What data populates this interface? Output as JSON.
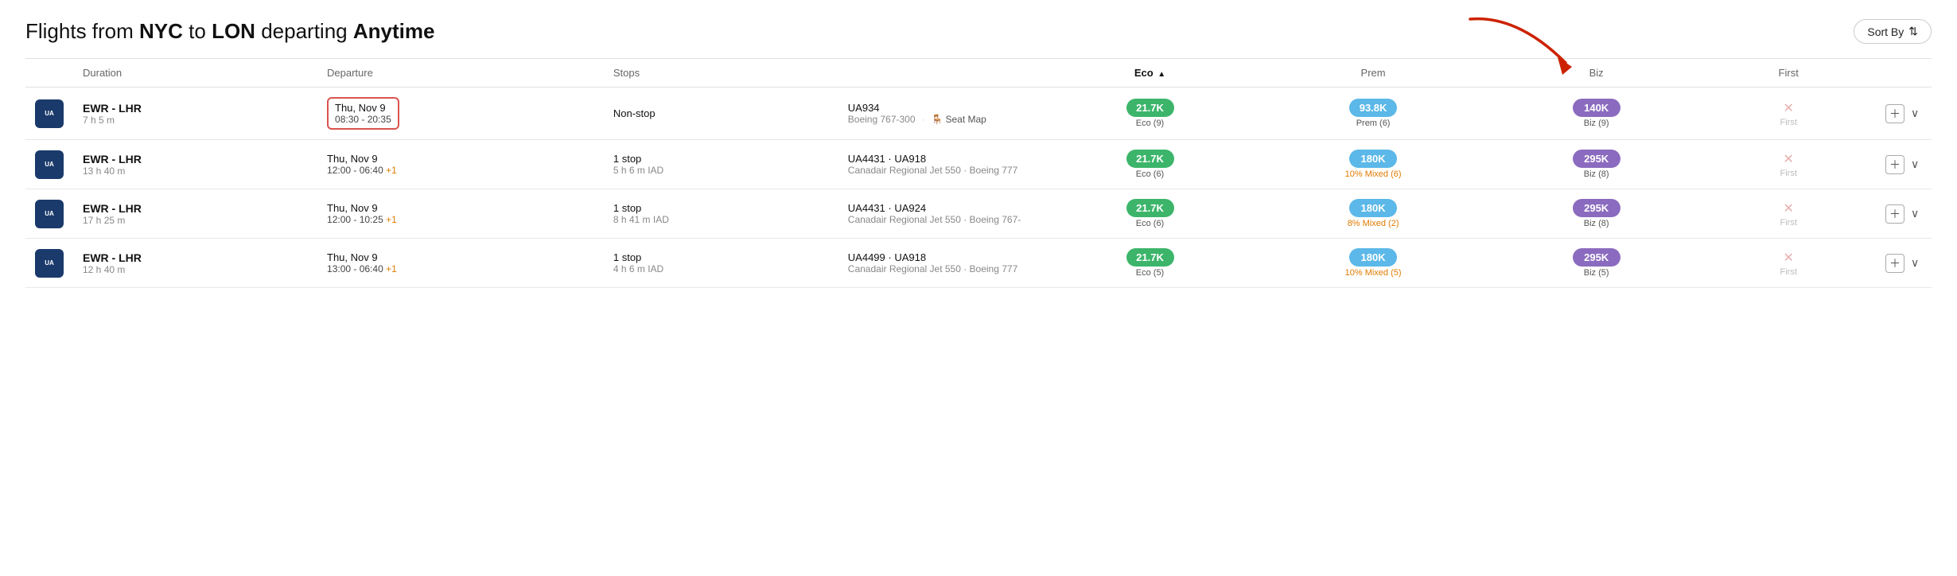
{
  "header": {
    "title_prefix": "Flights from ",
    "origin": "NYC",
    "title_mid": " to ",
    "destination": "LON",
    "title_suffix": " departing ",
    "depart_time": "Anytime",
    "sort_button": "Sort By"
  },
  "columns": {
    "duration": "Duration",
    "departure": "Departure",
    "stops": "Stops",
    "eco": "Eco",
    "prem": "Prem",
    "biz": "Biz",
    "first": "First"
  },
  "flights": [
    {
      "route": "EWR - LHR",
      "duration": "7 h 5 m",
      "departure_date": "Thu, Nov 9",
      "departure_time": "08:30 - 20:35",
      "departure_plus": "",
      "highlighted": true,
      "stops_label": "Non-stop",
      "stops_detail": "",
      "flight_codes": "UA934",
      "aircraft": "Boeing 767-300",
      "seat_map": "Seat Map",
      "eco_price": "21.7K",
      "eco_sub": "Eco (9)",
      "prem_price": "93.8K",
      "prem_sub": "Prem (6)",
      "biz_price": "140K",
      "biz_sub": "Biz (9)",
      "first_available": false,
      "first_label": "First"
    },
    {
      "route": "EWR - LHR",
      "duration": "13 h 40 m",
      "departure_date": "Thu, Nov 9",
      "departure_time": "12:00 - 06:40",
      "departure_plus": "+1",
      "highlighted": false,
      "stops_label": "1 stop",
      "stops_detail": "5 h 6 m IAD",
      "flight_codes": "UA4431 · UA918",
      "aircraft": "Canadair Regional Jet 550 · Boeing 777",
      "seat_map": "",
      "eco_price": "21.7K",
      "eco_sub": "Eco (6)",
      "prem_price": "180K",
      "prem_sub": "10% Mixed (6)",
      "prem_mixed": true,
      "biz_price": "295K",
      "biz_sub": "Biz (8)",
      "first_available": false,
      "first_label": "First"
    },
    {
      "route": "EWR - LHR",
      "duration": "17 h 25 m",
      "departure_date": "Thu, Nov 9",
      "departure_time": "12:00 - 10:25",
      "departure_plus": "+1",
      "highlighted": false,
      "stops_label": "1 stop",
      "stops_detail": "8 h 41 m IAD",
      "flight_codes": "UA4431 · UA924",
      "aircraft": "Canadair Regional Jet 550 · Boeing 767-",
      "seat_map": "",
      "eco_price": "21.7K",
      "eco_sub": "Eco (6)",
      "prem_price": "180K",
      "prem_sub": "8% Mixed (2)",
      "prem_mixed": true,
      "biz_price": "295K",
      "biz_sub": "Biz (8)",
      "first_available": false,
      "first_label": "First"
    },
    {
      "route": "EWR - LHR",
      "duration": "12 h 40 m",
      "departure_date": "Thu, Nov 9",
      "departure_time": "13:00 - 06:40",
      "departure_plus": "+1",
      "highlighted": false,
      "stops_label": "1 stop",
      "stops_detail": "4 h 6 m IAD",
      "flight_codes": "UA4499 · UA918",
      "aircraft": "Canadair Regional Jet 550 · Boeing 777",
      "seat_map": "",
      "eco_price": "21.7K",
      "eco_sub": "Eco (5)",
      "prem_price": "180K",
      "prem_sub": "10% Mixed (5)",
      "prem_mixed": true,
      "biz_price": "295K",
      "biz_sub": "Biz (5)",
      "first_available": false,
      "first_label": "First"
    }
  ]
}
